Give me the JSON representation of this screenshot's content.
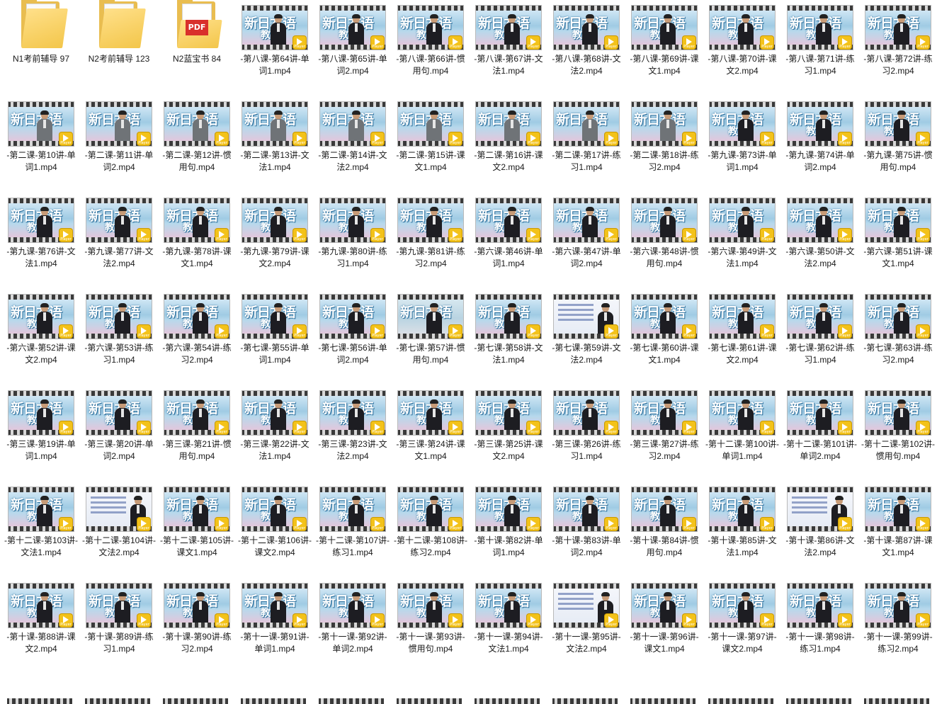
{
  "window": {
    "title": ""
  },
  "files": [
    {
      "name": "N1考前辅导  97",
      "type": "folder"
    },
    {
      "name": "N2考前辅导  123",
      "type": "folder"
    },
    {
      "name": "N2蓝宝书  84",
      "type": "folder-pdf",
      "badge": "PDF"
    },
    {
      "name": "-第八课-第64讲-单词1.mp4",
      "type": "video",
      "variant": "logo"
    },
    {
      "name": "-第八课-第65讲-单词2.mp4",
      "type": "video",
      "variant": "logo"
    },
    {
      "name": "-第八课-第66讲-惯用句.mp4",
      "type": "video",
      "variant": "logo"
    },
    {
      "name": "-第八课-第67讲-文法1.mp4",
      "type": "video",
      "variant": "logo"
    },
    {
      "name": "-第八课-第68讲-文法2.mp4",
      "type": "video",
      "variant": "logo"
    },
    {
      "name": "-第八课-第69讲-课文1.mp4",
      "type": "video",
      "variant": "logo"
    },
    {
      "name": "-第八课-第70讲-课文2.mp4",
      "type": "video",
      "variant": "logo"
    },
    {
      "name": "-第八课-第71讲-练习1.mp4",
      "type": "video",
      "variant": "logo"
    },
    {
      "name": "-第八课-第72讲-练习2.mp4",
      "type": "video",
      "variant": "logo"
    },
    {
      "name": "-第二课-第10讲-单词1.mp4",
      "type": "video",
      "variant": "gray"
    },
    {
      "name": "-第二课-第11讲-单词2.mp4",
      "type": "video",
      "variant": "gray"
    },
    {
      "name": "-第二课-第12讲-惯用句.mp4",
      "type": "video",
      "variant": "gray"
    },
    {
      "name": "-第二课-第13讲-文法1.mp4",
      "type": "video",
      "variant": "gray"
    },
    {
      "name": "-第二课-第14讲-文法2.mp4",
      "type": "video",
      "variant": "gray"
    },
    {
      "name": "-第二课-第15讲-课文1.mp4",
      "type": "video",
      "variant": "gray"
    },
    {
      "name": "-第二课-第16讲-课文2.mp4",
      "type": "video",
      "variant": "gray"
    },
    {
      "name": "-第二课-第17讲-练习1.mp4",
      "type": "video",
      "variant": "gray"
    },
    {
      "name": "-第二课-第18讲-练习2.mp4",
      "type": "video",
      "variant": "gray"
    },
    {
      "name": "-第九课-第73讲-单词1.mp4",
      "type": "video",
      "variant": "logo"
    },
    {
      "name": "-第九课-第74讲-单词2.mp4",
      "type": "video",
      "variant": "logo"
    },
    {
      "name": "-第九课-第75讲-惯用句.mp4",
      "type": "video",
      "variant": "logo"
    },
    {
      "name": "-第九课-第76讲-文法1.mp4",
      "type": "video",
      "variant": "logo"
    },
    {
      "name": "-第九课-第77讲-文法2.mp4",
      "type": "video",
      "variant": "logo"
    },
    {
      "name": "-第九课-第78讲-课文1.mp4",
      "type": "video",
      "variant": "logo"
    },
    {
      "name": "-第九课-第79讲-课文2.mp4",
      "type": "video",
      "variant": "logo"
    },
    {
      "name": "-第九课-第80讲-练习1.mp4",
      "type": "video",
      "variant": "logo"
    },
    {
      "name": "-第九课-第81讲-练习2.mp4",
      "type": "video",
      "variant": "logo"
    },
    {
      "name": "-第六课-第46讲-单词1.mp4",
      "type": "video",
      "variant": "logo"
    },
    {
      "name": "-第六课-第47讲-单词2.mp4",
      "type": "video",
      "variant": "logo"
    },
    {
      "name": "-第六课-第48讲-惯用句.mp4",
      "type": "video",
      "variant": "logo"
    },
    {
      "name": "-第六课-第49讲-文法1.mp4",
      "type": "video",
      "variant": "logo"
    },
    {
      "name": "-第六课-第50讲-文法2.mp4",
      "type": "video",
      "variant": "logo"
    },
    {
      "name": "-第六课-第51讲-课文1.mp4",
      "type": "video",
      "variant": "logo"
    },
    {
      "name": "-第六课-第52讲-课文2.mp4",
      "type": "video",
      "variant": "logo"
    },
    {
      "name": "-第六课-第53讲-练习1.mp4",
      "type": "video",
      "variant": "logo"
    },
    {
      "name": "-第六课-第54讲-练习2.mp4",
      "type": "video",
      "variant": "logo"
    },
    {
      "name": "-第七课-第55讲-单词1.mp4",
      "type": "video",
      "variant": "logo"
    },
    {
      "name": "-第七课-第56讲-单词2.mp4",
      "type": "video",
      "variant": "logo"
    },
    {
      "name": "-第七课-第57讲-惯用句.mp4",
      "type": "video",
      "variant": "alt"
    },
    {
      "name": "-第七课-第58讲-文法1.mp4",
      "type": "video",
      "variant": "logo"
    },
    {
      "name": "-第七课-第59讲-文法2.mp4",
      "type": "video",
      "variant": "slide"
    },
    {
      "name": "-第七课-第60讲-课文1.mp4",
      "type": "video",
      "variant": "logo"
    },
    {
      "name": "-第七课-第61讲-课文2.mp4",
      "type": "video",
      "variant": "logo"
    },
    {
      "name": "-第七课-第62讲-练习1.mp4",
      "type": "video",
      "variant": "logo"
    },
    {
      "name": "-第七课-第63讲-练习2.mp4",
      "type": "video",
      "variant": "logo"
    },
    {
      "name": "-第三课-第19讲-单词1.mp4",
      "type": "video",
      "variant": "logo"
    },
    {
      "name": "-第三课-第20讲-单词2.mp4",
      "type": "video",
      "variant": "logo"
    },
    {
      "name": "-第三课-第21讲-惯用句.mp4",
      "type": "video",
      "variant": "logo"
    },
    {
      "name": "-第三课-第22讲-文法1.mp4",
      "type": "video",
      "variant": "logo"
    },
    {
      "name": "-第三课-第23讲-文法2.mp4",
      "type": "video",
      "variant": "logo"
    },
    {
      "name": "-第三课-第24讲-课文1.mp4",
      "type": "video",
      "variant": "logo"
    },
    {
      "name": "-第三课-第25讲-课文2.mp4",
      "type": "video",
      "variant": "logo"
    },
    {
      "name": "-第三课-第26讲-练习1.mp4",
      "type": "video",
      "variant": "logo"
    },
    {
      "name": "-第三课-第27讲-练习2.mp4",
      "type": "video",
      "variant": "logo"
    },
    {
      "name": "-第十二课-第100讲-单词1.mp4",
      "type": "video",
      "variant": "logo"
    },
    {
      "name": "-第十二课-第101讲-单词2.mp4",
      "type": "video",
      "variant": "logo"
    },
    {
      "name": "-第十二课-第102讲-惯用句.mp4",
      "type": "video",
      "variant": "logo"
    },
    {
      "name": "-第十二课-第103讲-文法1.mp4",
      "type": "video",
      "variant": "logo"
    },
    {
      "name": "-第十二课-第104讲-文法2.mp4",
      "type": "video",
      "variant": "slide"
    },
    {
      "name": "-第十二课-第105讲-课文1.mp4",
      "type": "video",
      "variant": "logo"
    },
    {
      "name": "-第十二课-第106讲-课文2.mp4",
      "type": "video",
      "variant": "logo"
    },
    {
      "name": "-第十二课-第107讲-练习1.mp4",
      "type": "video",
      "variant": "logo"
    },
    {
      "name": "-第十二课-第108讲-练习2.mp4",
      "type": "video",
      "variant": "logo"
    },
    {
      "name": "-第十课-第82讲-单词1.mp4",
      "type": "video",
      "variant": "logo"
    },
    {
      "name": "-第十课-第83讲-单词2.mp4",
      "type": "video",
      "variant": "logo"
    },
    {
      "name": "-第十课-第84讲-惯用句.mp4",
      "type": "video",
      "variant": "logo"
    },
    {
      "name": "-第十课-第85讲-文法1.mp4",
      "type": "video",
      "variant": "logo"
    },
    {
      "name": "-第十课-第86讲-文法2.mp4",
      "type": "video",
      "variant": "slide"
    },
    {
      "name": "-第十课-第87讲-课文1.mp4",
      "type": "video",
      "variant": "logo"
    },
    {
      "name": "-第十课-第88讲-课文2.mp4",
      "type": "video",
      "variant": "logo"
    },
    {
      "name": "-第十课-第89讲-练习1.mp4",
      "type": "video",
      "variant": "logo"
    },
    {
      "name": "-第十课-第90讲-练习2.mp4",
      "type": "video",
      "variant": "logo"
    },
    {
      "name": "-第十一课-第91讲-单词1.mp4",
      "type": "video",
      "variant": "logo"
    },
    {
      "name": "-第十一课-第92讲-单词2.mp4",
      "type": "video",
      "variant": "logo"
    },
    {
      "name": "-第十一课-第93讲-惯用句.mp4",
      "type": "video",
      "variant": "logo"
    },
    {
      "name": "-第十一课-第94讲-文法1.mp4",
      "type": "video",
      "variant": "logo"
    },
    {
      "name": "-第十一课-第95讲-文法2.mp4",
      "type": "video",
      "variant": "slide"
    },
    {
      "name": "-第十一课-第96讲-课文1.mp4",
      "type": "video",
      "variant": "logo"
    },
    {
      "name": "-第十一课-第97讲-课文2.mp4",
      "type": "video",
      "variant": "logo"
    },
    {
      "name": "-第十一课-第98讲-练习1.mp4",
      "type": "video",
      "variant": "logo"
    },
    {
      "name": "-第十一课-第99讲-练习2.mp4",
      "type": "video",
      "variant": "logo"
    }
  ],
  "thumbnail_text": {
    "logo": "新日本语",
    "logo_sub": "教程",
    "play_badge": "Player"
  },
  "colors": {
    "folder": "#f3c64a",
    "play_badge": "#f3c21a",
    "pdf": "#d9302b"
  }
}
